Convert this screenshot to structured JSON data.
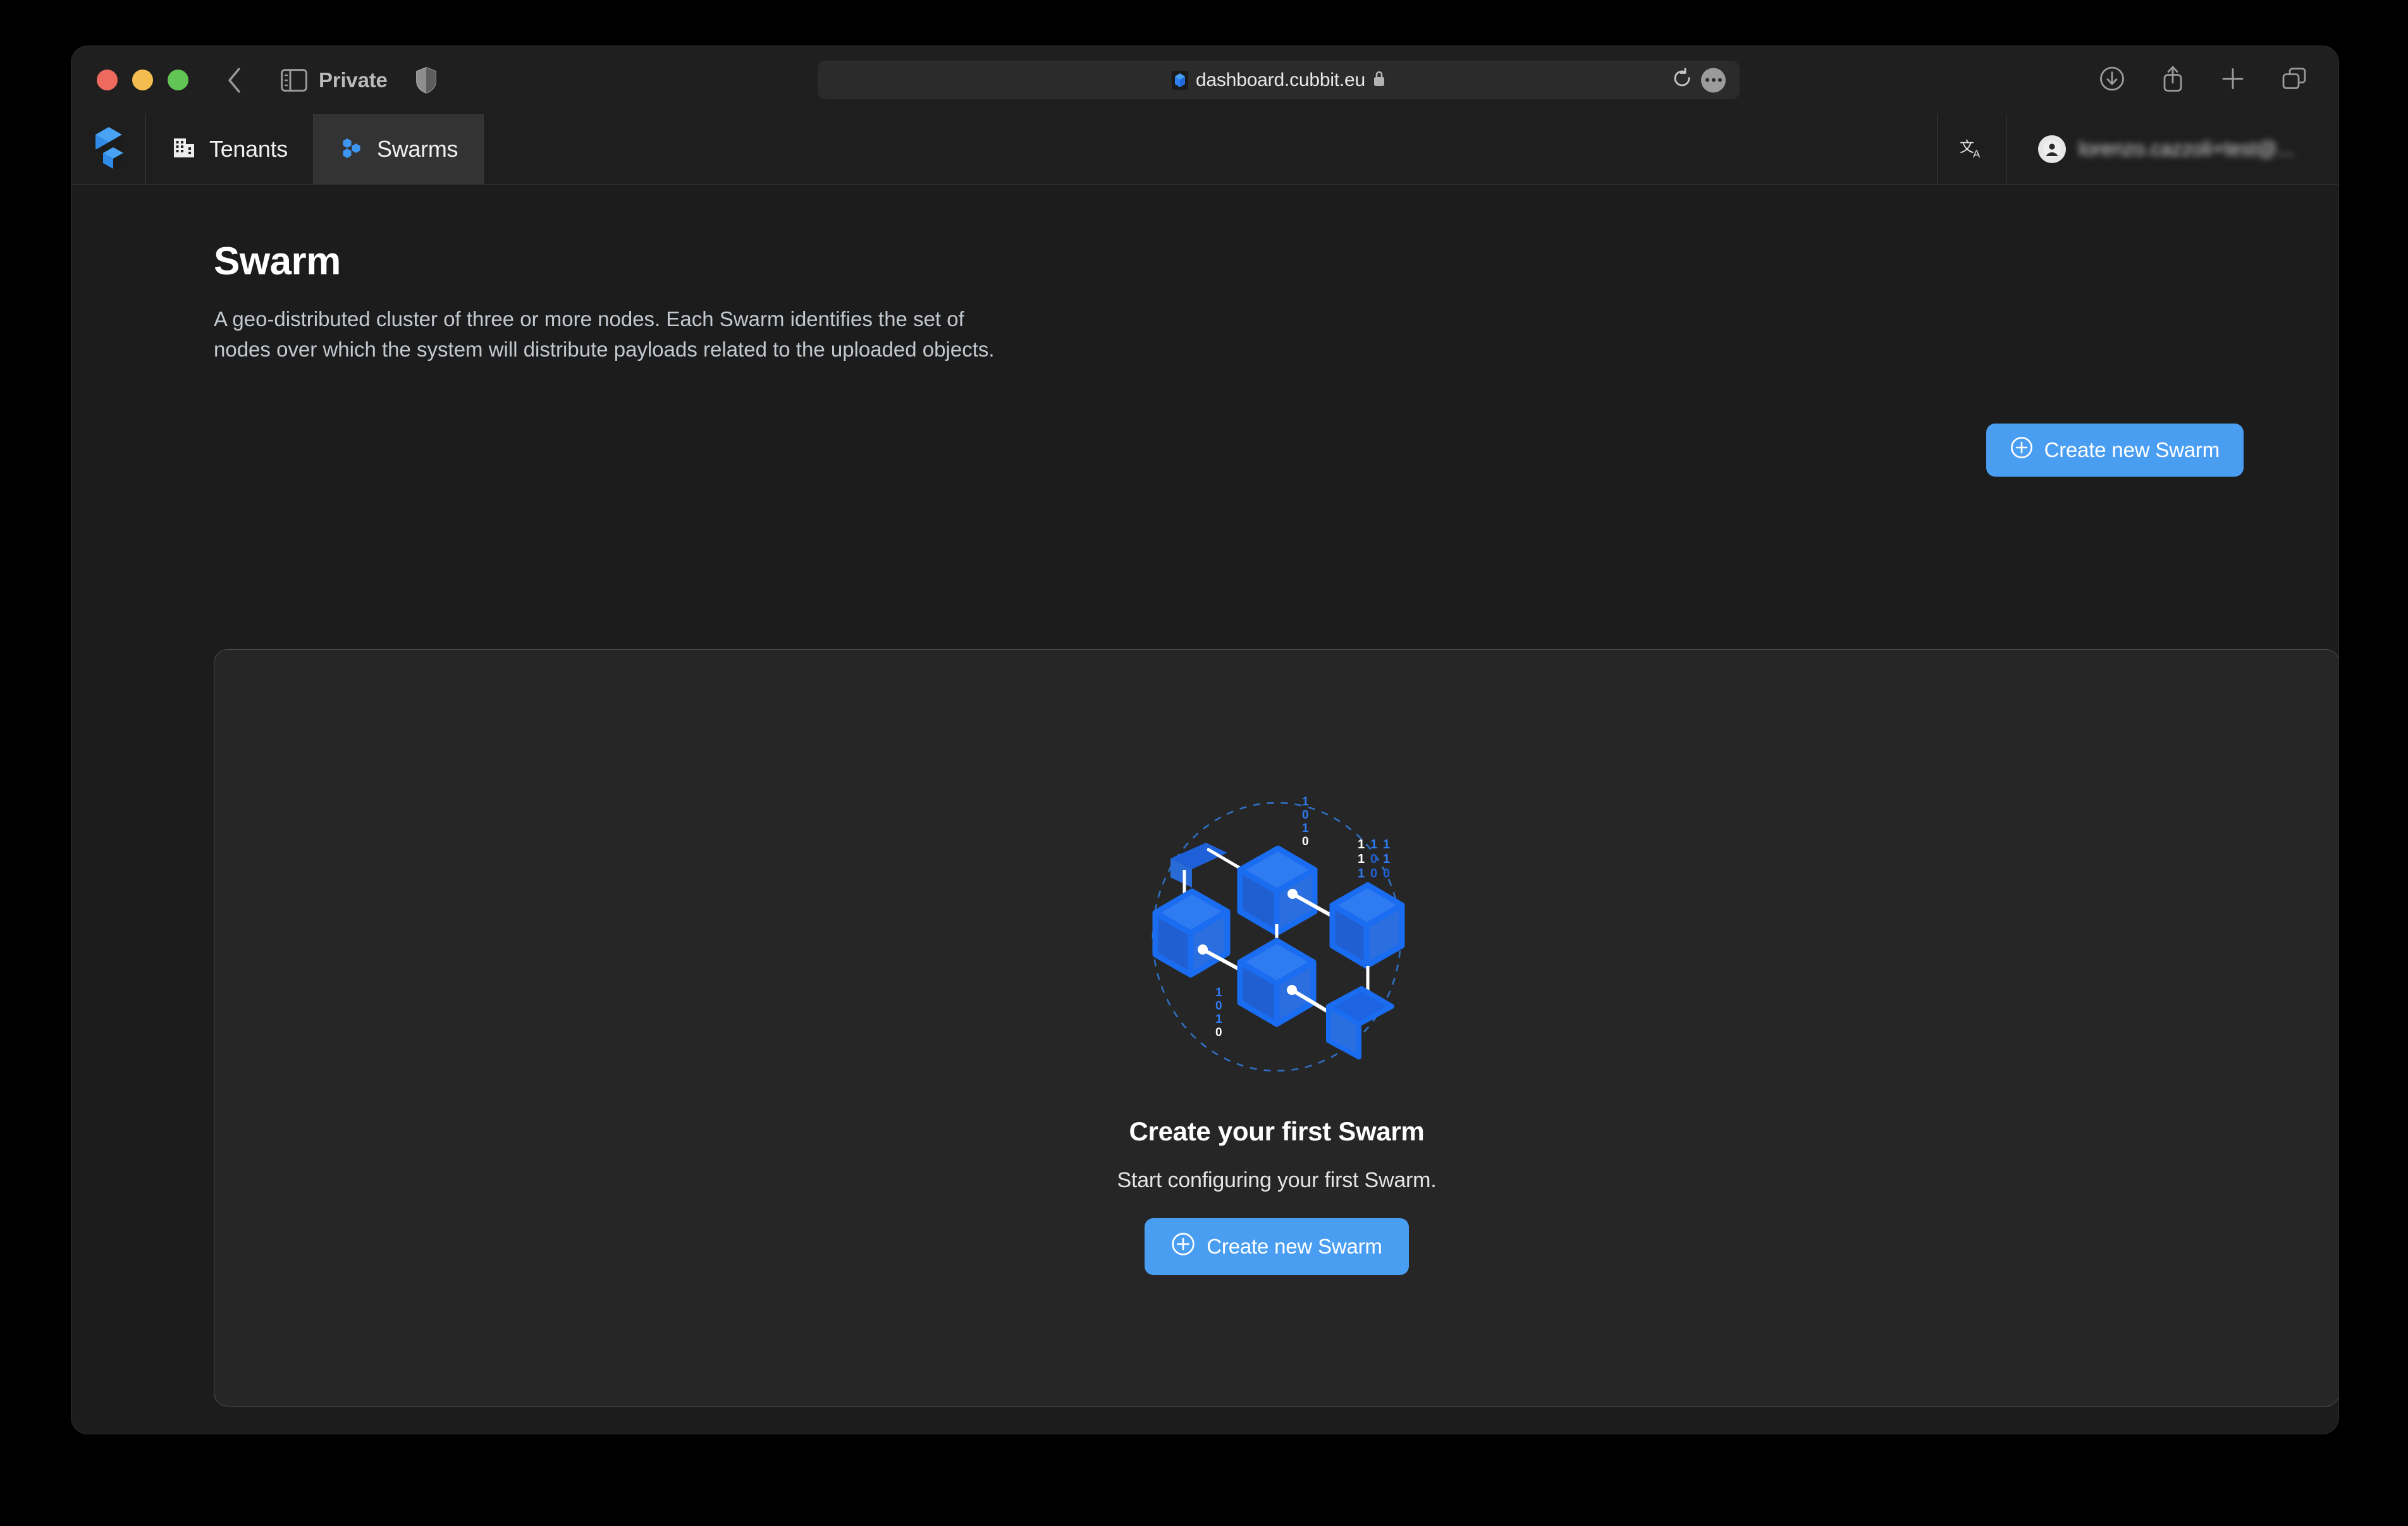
{
  "browser": {
    "window_controls": [
      "close",
      "minimize",
      "maximize"
    ],
    "back_icon": "chevron-left-icon",
    "sidebar_icon": "sidebar-toggle-icon",
    "private_label": "Private",
    "shield_icon": "privacy-shield-icon",
    "url": "dashboard.cubbit.eu",
    "favicon": "cubbit-favicon",
    "lock_icon": "lock-icon",
    "reload_icon": "reload-icon",
    "more_icon": "more-options-icon",
    "downloads_icon": "downloads-icon",
    "share_icon": "share-icon",
    "newtab_icon": "new-tab-icon",
    "tabs_icon": "tab-overview-icon"
  },
  "appnav": {
    "logo": "cubbit-logo",
    "tabs": [
      {
        "label": "Tenants",
        "icon": "building-icon",
        "active": false
      },
      {
        "label": "Swarms",
        "icon": "swarm-nodes-icon",
        "active": true
      }
    ],
    "translate_icon": "translate-icon",
    "user_name": "lorenzo.cazzoli+test@...",
    "avatar_icon": "user-avatar-icon"
  },
  "page": {
    "title": "Swarm",
    "description": "A geo-distributed cluster of three or more nodes. Each Swarm identifies the set of nodes over which the system will distribute payloads related to the uploaded objects.",
    "create_button_label": "Create new Swarm",
    "create_button_icon": "plus-circle-icon"
  },
  "empty_state": {
    "illustration": "swarm-nodes-illustration",
    "title": "Create your first Swarm",
    "subtitle": "Start configuring your first Swarm.",
    "button_label": "Create new Swarm",
    "button_icon": "plus-circle-icon",
    "binary_labels": [
      "1",
      "0",
      "1",
      "0",
      "1",
      "1",
      "0",
      "1",
      "0",
      "111",
      "110",
      "110"
    ]
  },
  "colors": {
    "accent_blue": "#4a9ef2",
    "illustration_blue": "#1a6cf0",
    "page_bg": "#1c1c1c",
    "card_bg": "#262626",
    "card_border": "#4d4d4d",
    "nav_bg": "#1e1e1e",
    "active_tab_bg": "#333333"
  }
}
